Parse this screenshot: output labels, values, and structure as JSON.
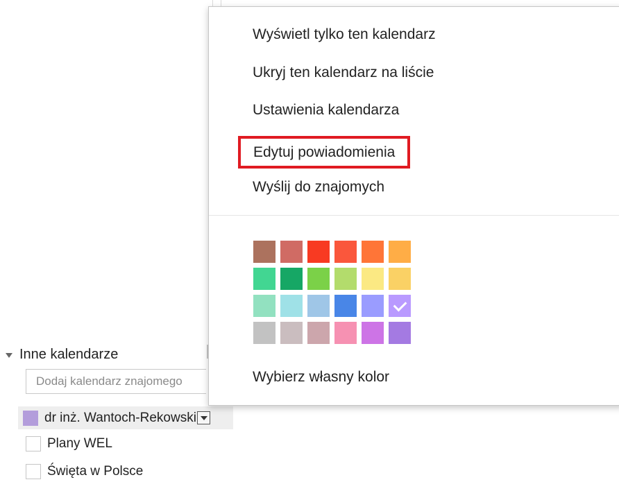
{
  "sidebar": {
    "section_title": "Inne kalendarze",
    "friend_input_placeholder": "Dodaj kalendarz znajomego",
    "calendars": [
      {
        "name": "dr inż. Wantoch-Rekowski",
        "color": "#b39ddb",
        "checked": true
      },
      {
        "name": "Plany WEL",
        "checked": false
      },
      {
        "name": "Święta w Polsce",
        "checked": false
      }
    ]
  },
  "menu": {
    "items": [
      "Wyświetl tylko ten kalendarz",
      "Ukryj ten kalendarz na liście",
      "Ustawienia kalendarza",
      "Edytuj powiadomienia",
      "Wyślij do znajomych"
    ],
    "highlighted_item": "Edytuj powiadomienia",
    "highlight_color": "#e01b22",
    "custom_color_label": "Wybierz własny kolor",
    "palette": [
      [
        "#ac725e",
        "#d06b64",
        "#f83a22",
        "#fa573c",
        "#ff7537",
        "#ffad46"
      ],
      [
        "#42d692",
        "#16a765",
        "#7bd148",
        "#b3dc6c",
        "#fbe983",
        "#fad165"
      ],
      [
        "#92e1c0",
        "#9fe1e7",
        "#9fc6e7",
        "#4986e7",
        "#9a9cff",
        "#b99aff"
      ],
      [
        "#c2c2c2",
        "#cabdbf",
        "#cca6ac",
        "#f691b2",
        "#cd74e6",
        "#a47ae2"
      ]
    ],
    "selected_swatch_color": "#b99aff"
  }
}
